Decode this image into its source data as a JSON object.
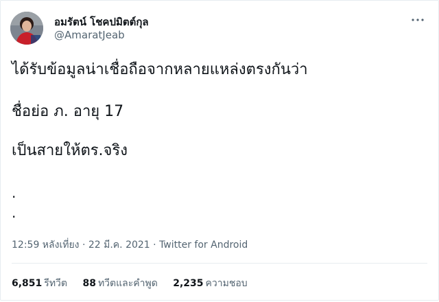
{
  "author": {
    "display_name": "อมรัตน์ โชคปมิตต์กุล",
    "handle": "@AmaratJeab",
    "avatar": "profile-photo"
  },
  "menu_icon": "more-horizontal-icon",
  "tweet": {
    "lines": [
      "ได้รับข้อมูลน่าเชื่อถือจากหลายแหล่งตรงกันว่า",
      "ชื่อย่อ ภ. อายุ 17",
      "เป็นสายให้ตร.จริง",
      ".",
      "."
    ]
  },
  "meta": {
    "time": "12:59 หลังเที่ยง",
    "separator": " · ",
    "date": "22 มี.ค. 2021",
    "source": "Twitter for Android"
  },
  "stats": {
    "retweets": {
      "count": "6,851",
      "label": "รีทวีต"
    },
    "quotes": {
      "count": "88",
      "label": "ทวีตและคำพูด"
    },
    "likes": {
      "count": "2,235",
      "label": "ความชอบ"
    }
  },
  "colors": {
    "text_primary": "#0f1419",
    "text_secondary": "#536471",
    "divider": "#e6ecf0"
  }
}
